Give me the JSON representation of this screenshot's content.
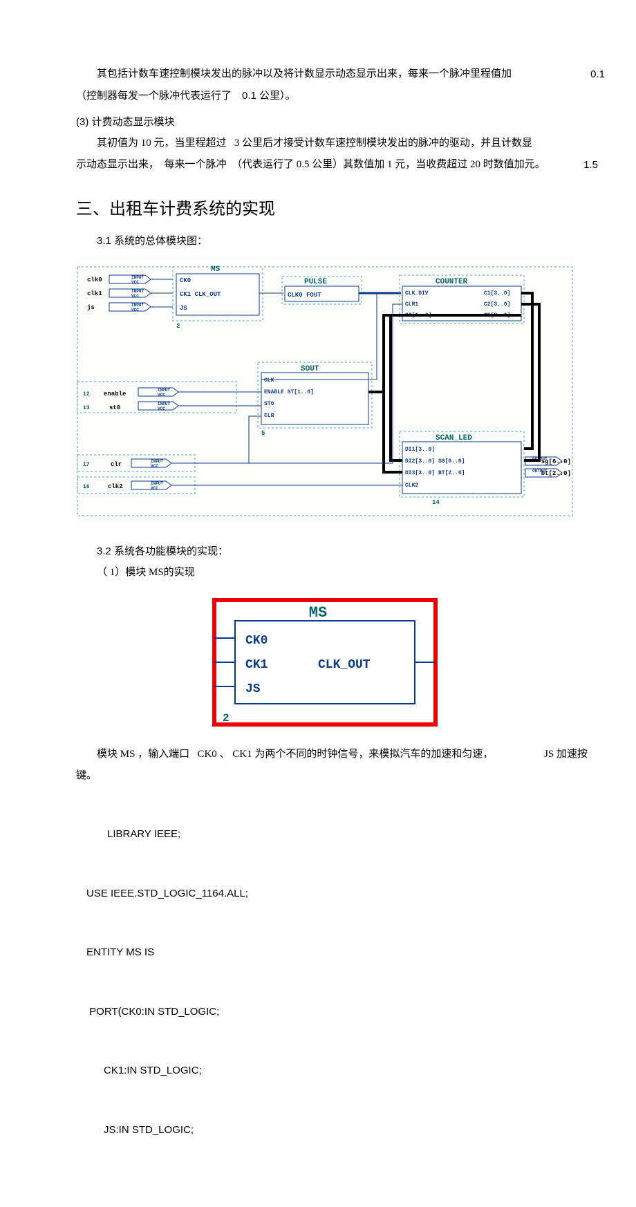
{
  "p1": {
    "text": "其包括计数车速控制模块发出的脉冲以及将计数显示动态显示出来，每来一个脉冲里程值加",
    "suffix": "0.1",
    "line2a": "（控制器每发一个脉冲代表运行了",
    "line2b": "0.1 公里）。"
  },
  "p2_title": "(3) 计费动态显示模块",
  "p2": {
    "l1a": "其初值为 10 元，当里程超过",
    "l1b": "3 公里后才接受计数车速控制模块发出的脉冲的驱动，并且计数显",
    "l2a": "示动态显示出来，",
    "l2b": "每来一个脉冲",
    "l2c": "（代表运行了 0.5 公里）其数值加 1 元，当收费超过 20 时数值加元。",
    "suffix": "1.5"
  },
  "h2": "三、出租车计费系统的实现",
  "s31": "3.1 系统的总体模块图：",
  "s32": "3.2 系统各功能模块的实现：",
  "s32a": "（ 1）模块  MS的实现",
  "diag1": {
    "ms": "MS",
    "ck0": "CK0",
    "ck1": "CK1  CLK_OUT",
    "js": "JS",
    "pulse": "PULSE",
    "clk0fout": "CLK0  FOUT",
    "counter": "COUNTER",
    "clk_div": "CLK_DIV",
    "c1": "C1[3..0]",
    "clr1": "CLR1",
    "c2": "C2[3..0]",
    "si": "SI[1..0]",
    "c3": "C3[3..0]",
    "sout": "SOUT",
    "s_clk": "CLK",
    "s_enable": "ENABLE  ST[1..0]",
    "s_st0": "ST0",
    "s_clr": "CLR",
    "scan_led": "SCAN_LED",
    "di1": "DI1[3..0]",
    "di2": "DI2[3..0]  SG[6..0]",
    "di3": "DI3[3..0]  BT[2..0]",
    "clk2": "CLK2",
    "in_clk0": "clk0",
    "in_clk1": "clk1",
    "in_js": "js",
    "in_enable": "enable",
    "in_st0": "st0",
    "in_clr": "clr",
    "in_clk2": "clk2",
    "out_sg": "sg[6..0]",
    "out_bt": "bt[2..0]",
    "input": "INPUT",
    "vcc": "VCC",
    "output": "OUTPUT"
  },
  "diag2": {
    "title": "MS",
    "ck0": "CK0",
    "ck1": "CK1",
    "clkout": "CLK_OUT",
    "js": "JS",
    "num": "2"
  },
  "p3": {
    "l1a": "模块 MS ，输入端口",
    "l1b": "CK0 、 CK1 为两个不同的时钟信号，来模拟汽车的加速和匀速，",
    "suffix": "JS 加速按",
    "l2": "键。"
  },
  "code": {
    "c1": "LIBRARY IEEE;",
    "c2": "USE IEEE.STD_LOGIC_1164.ALL;",
    "c3": "ENTITY MS IS",
    "c4": " PORT(CK0:IN STD_LOGIC;",
    "c5": "      CK1:IN STD_LOGIC;",
    "c6": "      JS:IN STD_LOGIC;"
  }
}
